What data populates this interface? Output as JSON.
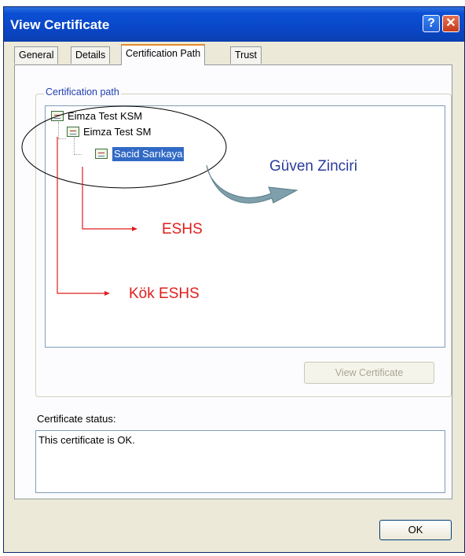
{
  "window": {
    "title": "View Certificate",
    "help_glyph": "?",
    "close_glyph": "✕"
  },
  "tabs": [
    {
      "label": "General",
      "active": false
    },
    {
      "label": "Details",
      "active": false
    },
    {
      "label": "Certification Path",
      "active": true
    },
    {
      "label": "Trust",
      "active": false
    }
  ],
  "cert_path": {
    "group_label": "Certification path",
    "items": [
      {
        "label": "Eimza Test KSM",
        "selected": false
      },
      {
        "label": "Eimza Test SM",
        "selected": false
      },
      {
        "label": "Sacid Sarıkaya",
        "selected": true
      }
    ],
    "view_certificate_label": "View Certificate"
  },
  "status": {
    "label": "Certificate status:",
    "text": "This certificate is OK."
  },
  "buttons": {
    "ok_label": "OK"
  },
  "annotations": {
    "chain_label": "Güven Zinciri",
    "eshs_label": "ESHS",
    "root_eshs_label": "Kök ESHS"
  },
  "colors": {
    "title_bar": "#0a47c8",
    "selection": "#316ac5",
    "annotation_blue": "#2b3c9e",
    "annotation_red": "#e01e1e"
  }
}
